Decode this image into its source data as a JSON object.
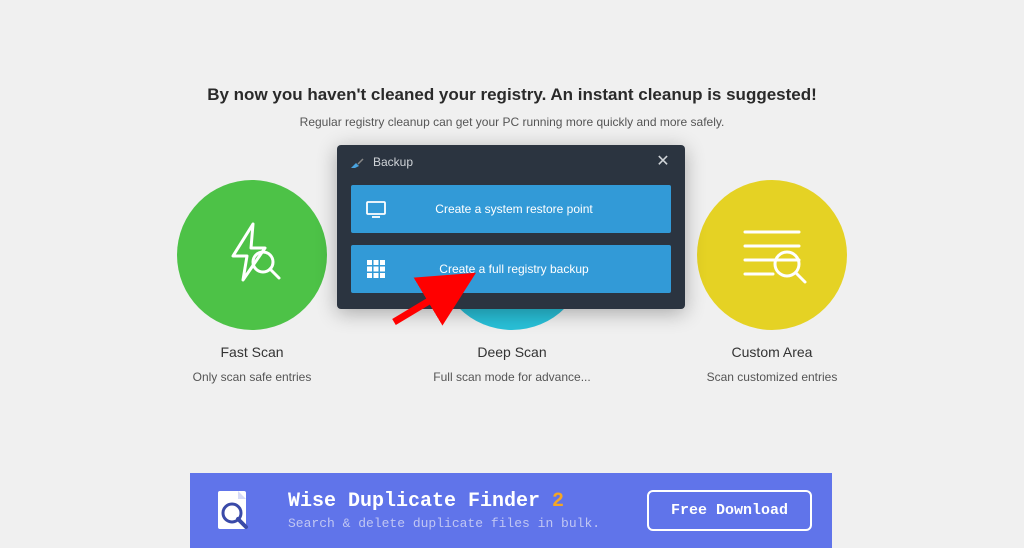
{
  "header": {
    "title": "By now you haven't cleaned your registry. An instant cleanup is suggested!",
    "subtitle": "Regular registry cleanup can get your PC running more quickly and more safely."
  },
  "scan_options": {
    "fast": {
      "title": "Fast Scan",
      "desc": "Only scan safe entries"
    },
    "deep": {
      "title": "Deep Scan",
      "desc": "Full scan mode for advance..."
    },
    "custom": {
      "title": "Custom Area",
      "desc": "Scan customized entries"
    }
  },
  "backup_dialog": {
    "title": "Backup",
    "restore_point_label": "Create a system restore point",
    "full_backup_label": "Create a full registry backup"
  },
  "promo": {
    "title_prefix": "Wise Duplicate Finder ",
    "title_suffix": "2",
    "subtitle": "Search & delete duplicate files in bulk.",
    "cta": "Free Download"
  },
  "colors": {
    "green": "#4dc247",
    "blue": "#29c0d8",
    "yellow": "#e5d224",
    "dialog_bg": "#2b3440",
    "dialog_btn": "#329ad7",
    "banner": "#6074ea",
    "accent_orange": "#f5a623"
  }
}
